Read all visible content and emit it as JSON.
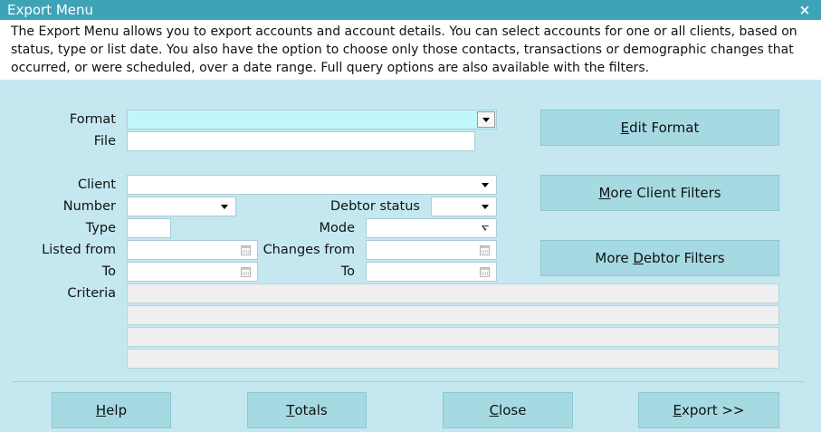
{
  "window": {
    "title": "Export Menu",
    "close_glyph": "×"
  },
  "description": "The Export Menu allows you to export accounts and account details. You can select accounts for one or all clients, based on status, type or list date. You also have the option to choose only those contacts, transactions or demographic changes that occurred, or were scheduled, over a date range. Full query options are also available with the filters.",
  "labels": {
    "format": "Format",
    "file": "File",
    "client": "Client",
    "number": "Number",
    "debtor_status": "Debtor status",
    "type": "Type",
    "mode": "Mode",
    "listed_from": "Listed from",
    "changes_from": "Changes from",
    "to": "To",
    "to2": "To",
    "criteria": "Criteria"
  },
  "fields": {
    "format": "",
    "file": "",
    "client": "",
    "number": "",
    "debtor_status": "",
    "type": "",
    "mode": "",
    "listed_from": "",
    "listed_to": "",
    "changes_from": "",
    "changes_to": "",
    "criteria": [
      "",
      "",
      "",
      ""
    ]
  },
  "buttons": {
    "edit_format": {
      "mnemonic": "E",
      "rest": "dit Format"
    },
    "more_client_filters": {
      "mnemonic": "M",
      "rest": "ore Client Filters"
    },
    "more_debtor_filters": {
      "before": "More ",
      "mnemonic": "D",
      "rest": "ebtor Filters"
    },
    "help": {
      "mnemonic": "H",
      "rest": "elp"
    },
    "totals": {
      "mnemonic": "T",
      "rest": "otals"
    },
    "close": {
      "mnemonic": "C",
      "rest": "lose"
    },
    "export": {
      "mnemonic": "E",
      "rest": "xport >>"
    }
  },
  "colors": {
    "titlebar": "#3fa3b8",
    "background": "#c5e8f0",
    "button": "#a5dae3",
    "format_field_highlight": "#c0f7fa",
    "readonly_field": "#efefef"
  },
  "icons": {
    "dropdown": "chevron-down-icon",
    "date": "calendar-icon"
  }
}
